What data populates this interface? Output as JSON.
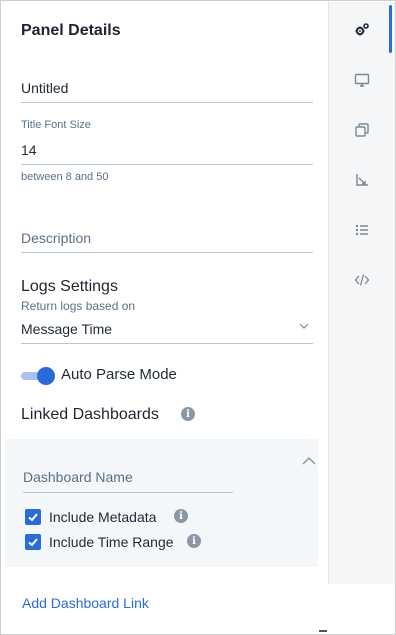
{
  "panel": {
    "title": "Panel Details",
    "title_value": "Untitled",
    "font_size_label": "Title Font Size",
    "font_size_value": "14",
    "font_size_hint": "between 8 and 50",
    "description_placeholder": "Description"
  },
  "logs": {
    "heading": "Logs Settings",
    "based_on_label": "Return logs based on",
    "based_on_value": "Message Time",
    "auto_parse_label": "Auto Parse Mode",
    "auto_parse_on": true
  },
  "linked": {
    "heading": "Linked Dashboards",
    "dashboard_name_placeholder": "Dashboard Name",
    "include_metadata_label": "Include Metadata",
    "include_metadata_checked": true,
    "include_time_range_label": "Include Time Range",
    "include_time_range_checked": true,
    "add_link_label": "Add Dashboard Link"
  },
  "rail": {
    "items": [
      {
        "icon": "gears-icon",
        "active": true
      },
      {
        "icon": "monitor-icon",
        "active": false
      },
      {
        "icon": "clone-icon",
        "active": false
      },
      {
        "icon": "axis-icon",
        "active": false
      },
      {
        "icon": "list-icon",
        "active": false
      },
      {
        "icon": "code-icon",
        "active": false
      }
    ]
  },
  "colors": {
    "accent": "#2a6bdc",
    "rail_bg": "#f4f6f8",
    "linked_bg": "#f4f7fa",
    "muted_text": "#5a7188"
  }
}
